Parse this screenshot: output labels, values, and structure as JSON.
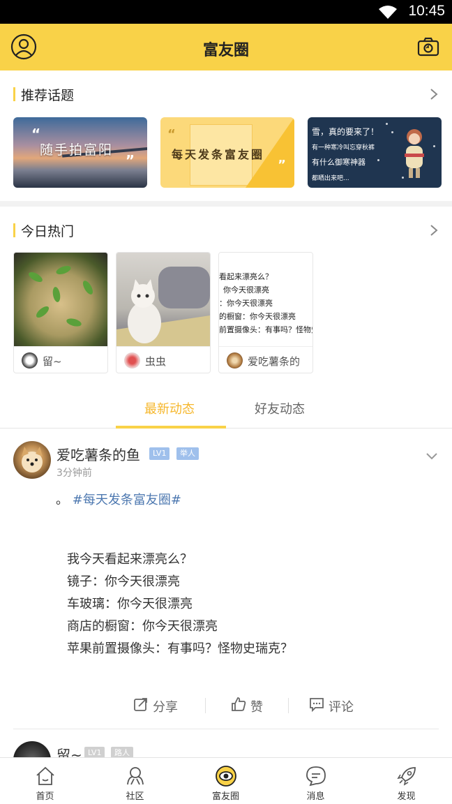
{
  "status_bar": {
    "time": "10:45"
  },
  "header": {
    "title": "富友圈"
  },
  "recommended": {
    "label": "推荐话题",
    "topics": [
      {
        "text": "随手拍富阳"
      },
      {
        "text": "每天发条富友圈"
      },
      {
        "lines": [
          "雪，真的要来了！",
          "有一种寒冷叫忘穿秋裤",
          "有什么御寒神器",
          "都晒出来吧..."
        ]
      }
    ]
  },
  "hot_today": {
    "label": "今日热门",
    "items": [
      {
        "user": "留~"
      },
      {
        "user": "虫虫"
      },
      {
        "user": "爱吃薯条的",
        "image_lines": [
          "看起来漂亮么？",
          "你今天很漂亮",
          "：你今天很漂亮",
          "的橱窗：你今天很漂亮",
          "前置摄像头：有事吗？怪物史"
        ]
      }
    ]
  },
  "tabs": {
    "active": "最新动态",
    "other": "好友动态"
  },
  "post": {
    "author": "爱吃薯条的鱼",
    "level": "LV1",
    "role": "举人",
    "time": "3分钟前",
    "prefix": "。",
    "topic": "#每天发条富友圈#",
    "lines": [
      "我今天看起来漂亮么？",
      "镜子：你今天很漂亮",
      "车玻璃：你今天很漂亮",
      "商店的橱窗：你今天很漂亮",
      "苹果前置摄像头：有事吗？怪物史瑞克？"
    ],
    "actions": {
      "share": "分享",
      "like": "赞",
      "comment": "评论"
    }
  },
  "post2": {
    "author": "留~",
    "level": "LV1",
    "role": "路人"
  },
  "nav": {
    "items": [
      {
        "label": "首页",
        "icon": "home-icon"
      },
      {
        "label": "社区",
        "icon": "community-icon"
      },
      {
        "label": "富友圈",
        "icon": "moments-icon"
      },
      {
        "label": "消息",
        "icon": "message-icon"
      },
      {
        "label": "发现",
        "icon": "discover-icon"
      }
    ]
  },
  "colors": {
    "accent": "#f9d248",
    "active_tab": "#f6b72c",
    "link": "#4d78b0"
  }
}
